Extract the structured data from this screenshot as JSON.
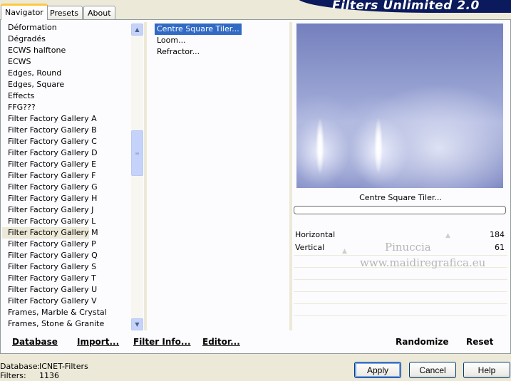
{
  "app_title": "Filters Unlimited 2.0",
  "tabs": [
    "Navigator",
    "Presets",
    "About"
  ],
  "categories": [
    "Déformation",
    "Dégradés",
    "ECWS halftone",
    "ECWS",
    "Edges, Round",
    "Edges, Square",
    "Effects",
    "FFG???",
    "Filter Factory Gallery A",
    "Filter Factory Gallery B",
    "Filter Factory Gallery C",
    "Filter Factory Gallery D",
    "Filter Factory Gallery E",
    "Filter Factory Gallery F",
    "Filter Factory Gallery G",
    "Filter Factory Gallery H",
    "Filter Factory Gallery J",
    "Filter Factory Gallery L",
    "Filter Factory Gallery M",
    "Filter Factory Gallery P",
    "Filter Factory Gallery Q",
    "Filter Factory Gallery S",
    "Filter Factory Gallery T",
    "Filter Factory Gallery U",
    "Filter Factory Gallery V",
    "Frames, Marble & Crystal",
    "Frames, Stone & Granite"
  ],
  "selected_category": "Filter Factory Gallery M",
  "filters": [
    "Centre Square Tiler...",
    "Loom...",
    "Refractor..."
  ],
  "selected_filter": "Centre Square Tiler...",
  "preview_label": "Centre Square Tiler...",
  "params": [
    {
      "name": "Horizontal",
      "value": "184"
    },
    {
      "name": "Vertical",
      "value": "61"
    }
  ],
  "watermark": [
    "Pinuccia",
    "www.maidiregrafica.eu"
  ],
  "bottom_buttons": [
    "Database",
    "Import...",
    "Filter Info...",
    "Editor...",
    "Randomize",
    "Reset"
  ],
  "info": {
    "database_label": "Database:",
    "database_value": "ICNET-Filters",
    "filters_label": "Filters:",
    "filters_value": "1136"
  },
  "dialog_buttons": [
    "Apply",
    "Cancel",
    "Help"
  ]
}
